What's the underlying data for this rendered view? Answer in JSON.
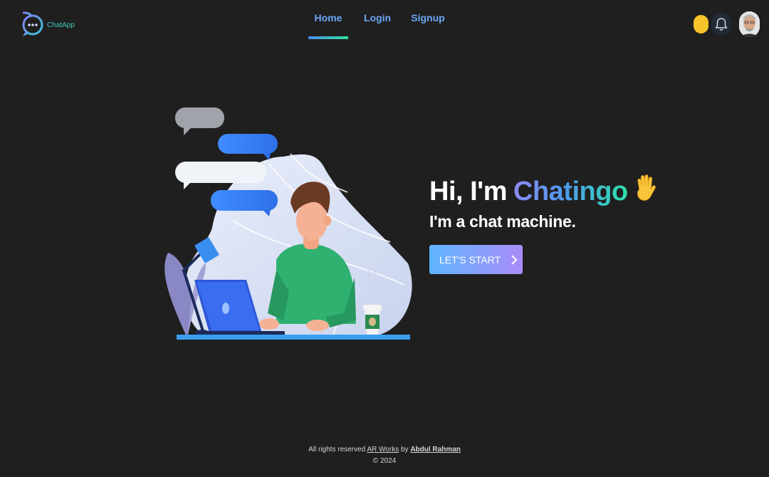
{
  "header": {
    "logo_text": "ChatApp",
    "nav": [
      {
        "label": "Home",
        "active": true
      },
      {
        "label": "Login",
        "active": false
      },
      {
        "label": "Signup",
        "active": false
      }
    ],
    "theme_icon": "sun-icon",
    "notification_icon": "bell-icon",
    "avatar_icon": "user-avatar"
  },
  "hero": {
    "greeting": "Hi, I'm",
    "name": "Chatingo",
    "emoji": "✋",
    "subtitle": "I'm a chat machine.",
    "cta_label": "LET'S START",
    "cta_icon": "chevron-right-icon"
  },
  "footer": {
    "rights_text": "All rights reserved",
    "company_link": "AR Works",
    "by_text": "by",
    "author_link": "Abdul Rahman",
    "copyright": "© 2024"
  },
  "colors": {
    "background": "#1f1f1f",
    "nav_link": "#6aa7f5",
    "accent_gradient_start": "#4a8cf0",
    "accent_gradient_end": "#2fe3a0",
    "button_gradient_start": "#5fb6ff",
    "button_gradient_end": "#a98cf8",
    "theme_toggle": "#f6c52c"
  }
}
